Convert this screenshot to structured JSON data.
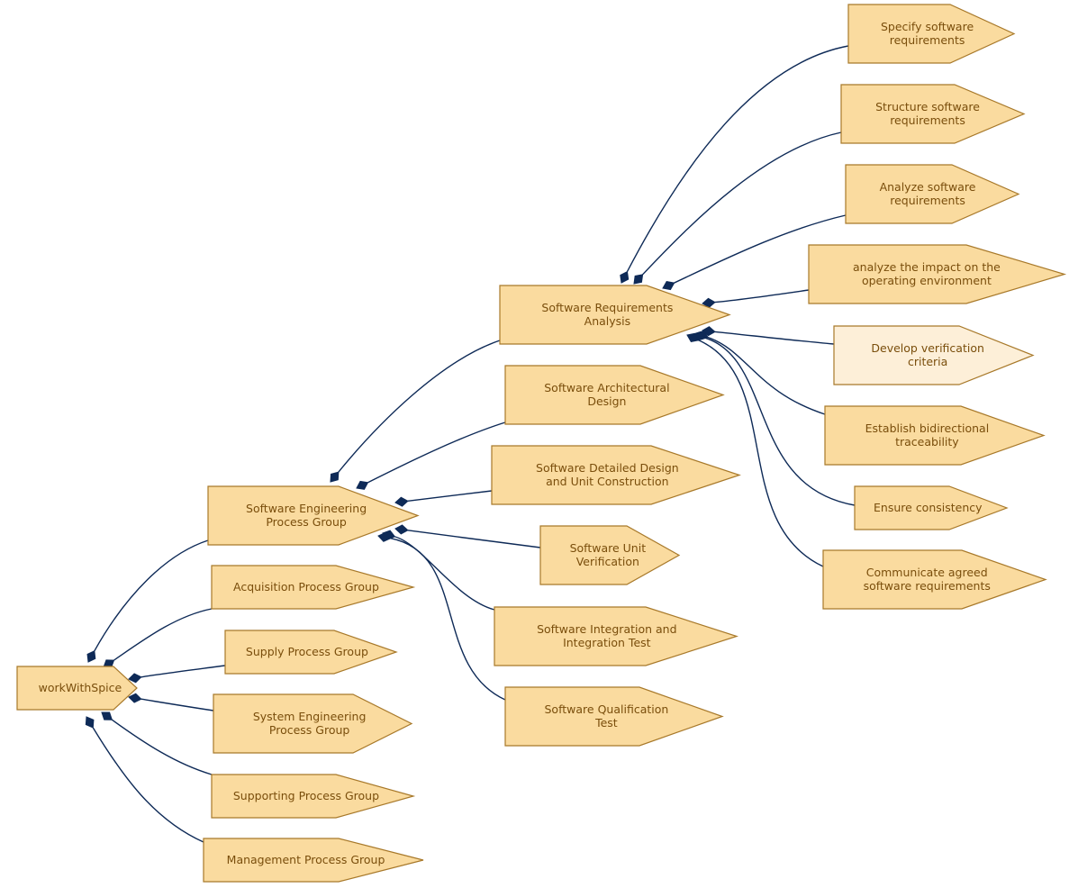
{
  "diagram": {
    "title": "workWithSpice",
    "colors": {
      "node_fill": "#fadb9f",
      "node_fill_highlight": "#fdefd8",
      "node_stroke": "#a8792a",
      "text": "#7a4e0c",
      "edge": "#0e2a57"
    },
    "nodes": [
      {
        "id": "root",
        "lines": [
          "workWithSpice"
        ]
      },
      {
        "id": "seng",
        "lines": [
          "Software Engineering",
          "Process Group"
        ]
      },
      {
        "id": "acq",
        "lines": [
          "Acquisition Process Group"
        ]
      },
      {
        "id": "sup",
        "lines": [
          "Supply Process Group"
        ]
      },
      {
        "id": "syseng",
        "lines": [
          "System Engineering",
          "Process Group"
        ]
      },
      {
        "id": "supp",
        "lines": [
          "Supporting Process Group"
        ]
      },
      {
        "id": "man",
        "lines": [
          "Management Process Group"
        ]
      },
      {
        "id": "sra",
        "lines": [
          "Software Requirements",
          "Analysis"
        ]
      },
      {
        "id": "sad",
        "lines": [
          "Software Architectural",
          "Design"
        ]
      },
      {
        "id": "sdd",
        "lines": [
          "Software Detailed Design",
          "and Unit Construction"
        ]
      },
      {
        "id": "suv",
        "lines": [
          "Software Unit",
          "Verification"
        ]
      },
      {
        "id": "sit",
        "lines": [
          "Software Integration and",
          "Integration Test"
        ]
      },
      {
        "id": "sqt",
        "lines": [
          "Software Qualification",
          "Test"
        ]
      },
      {
        "id": "spec",
        "lines": [
          "Specify software",
          "requirements"
        ]
      },
      {
        "id": "struct",
        "lines": [
          "Structure software",
          "requirements"
        ]
      },
      {
        "id": "anal",
        "lines": [
          "Analyze software",
          "requirements"
        ]
      },
      {
        "id": "impact",
        "lines": [
          "analyze the impact on the",
          "operating environment"
        ]
      },
      {
        "id": "verif",
        "lines": [
          "Develop verification",
          "criteria"
        ],
        "highlight": true
      },
      {
        "id": "trace",
        "lines": [
          "Establish bidirectional",
          "traceability"
        ]
      },
      {
        "id": "cons",
        "lines": [
          "Ensure consistency"
        ]
      },
      {
        "id": "comm",
        "lines": [
          "Communicate agreed",
          "software requirements"
        ]
      }
    ],
    "edges": [
      {
        "from": "root",
        "to": "seng"
      },
      {
        "from": "root",
        "to": "acq"
      },
      {
        "from": "root",
        "to": "sup"
      },
      {
        "from": "root",
        "to": "syseng"
      },
      {
        "from": "root",
        "to": "supp"
      },
      {
        "from": "root",
        "to": "man"
      },
      {
        "from": "seng",
        "to": "sra"
      },
      {
        "from": "seng",
        "to": "sad"
      },
      {
        "from": "seng",
        "to": "sdd"
      },
      {
        "from": "seng",
        "to": "suv"
      },
      {
        "from": "seng",
        "to": "sit"
      },
      {
        "from": "seng",
        "to": "sqt"
      },
      {
        "from": "sra",
        "to": "spec"
      },
      {
        "from": "sra",
        "to": "struct"
      },
      {
        "from": "sra",
        "to": "anal"
      },
      {
        "from": "sra",
        "to": "impact"
      },
      {
        "from": "sra",
        "to": "verif"
      },
      {
        "from": "sra",
        "to": "trace"
      },
      {
        "from": "sra",
        "to": "cons"
      },
      {
        "from": "sra",
        "to": "comm"
      }
    ]
  }
}
